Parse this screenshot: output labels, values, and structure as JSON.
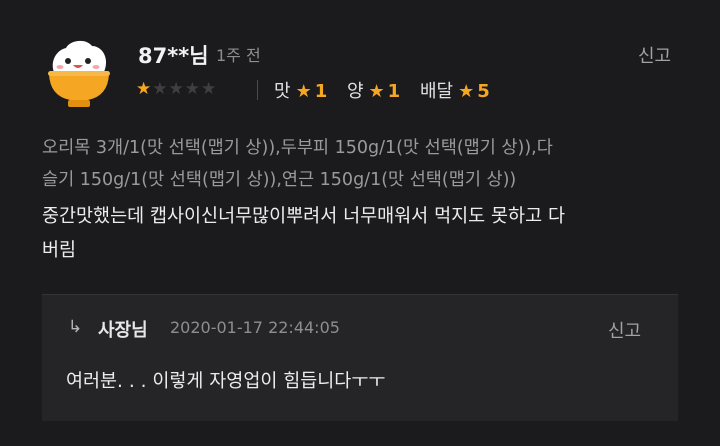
{
  "review": {
    "nickname": "87**님",
    "time_ago": "1주 전",
    "report_label": "신고",
    "overall_rating": 1,
    "overall_max": 5,
    "ratings": [
      {
        "label": "맛",
        "value": "1"
      },
      {
        "label": "양",
        "value": "1"
      },
      {
        "label": "배달",
        "value": "5"
      }
    ],
    "menu_lines": [
      "오리목 3개/1(맛 선택(맵기 상)),두부피 150g/1(맛 선택(맵기 상)),다",
      "슬기 150g/1(맛 선택(맵기 상)),연근 150g/1(맛 선택(맵기 상))"
    ],
    "body_lines": [
      "중간맛했는데 캡사이신너무많이뿌려서 너무매워서 먹지도 못하고 다",
      "버림"
    ]
  },
  "reply": {
    "author": "사장님",
    "date": "2020-01-17 22:44:05",
    "report_label": "신고",
    "text": "여러분. . . 이렇게 자영업이 힘듭니다ㅜㅜ"
  },
  "colors": {
    "background": "#1b1b1d",
    "reply_background": "#252528",
    "star_accent": "#f5a623",
    "avatar_bowl": "#f5a623"
  },
  "icons": {
    "avatar": "rice-bowl-face-icon",
    "reply_arrow": "reply-arrow-icon",
    "star": "star-icon"
  }
}
